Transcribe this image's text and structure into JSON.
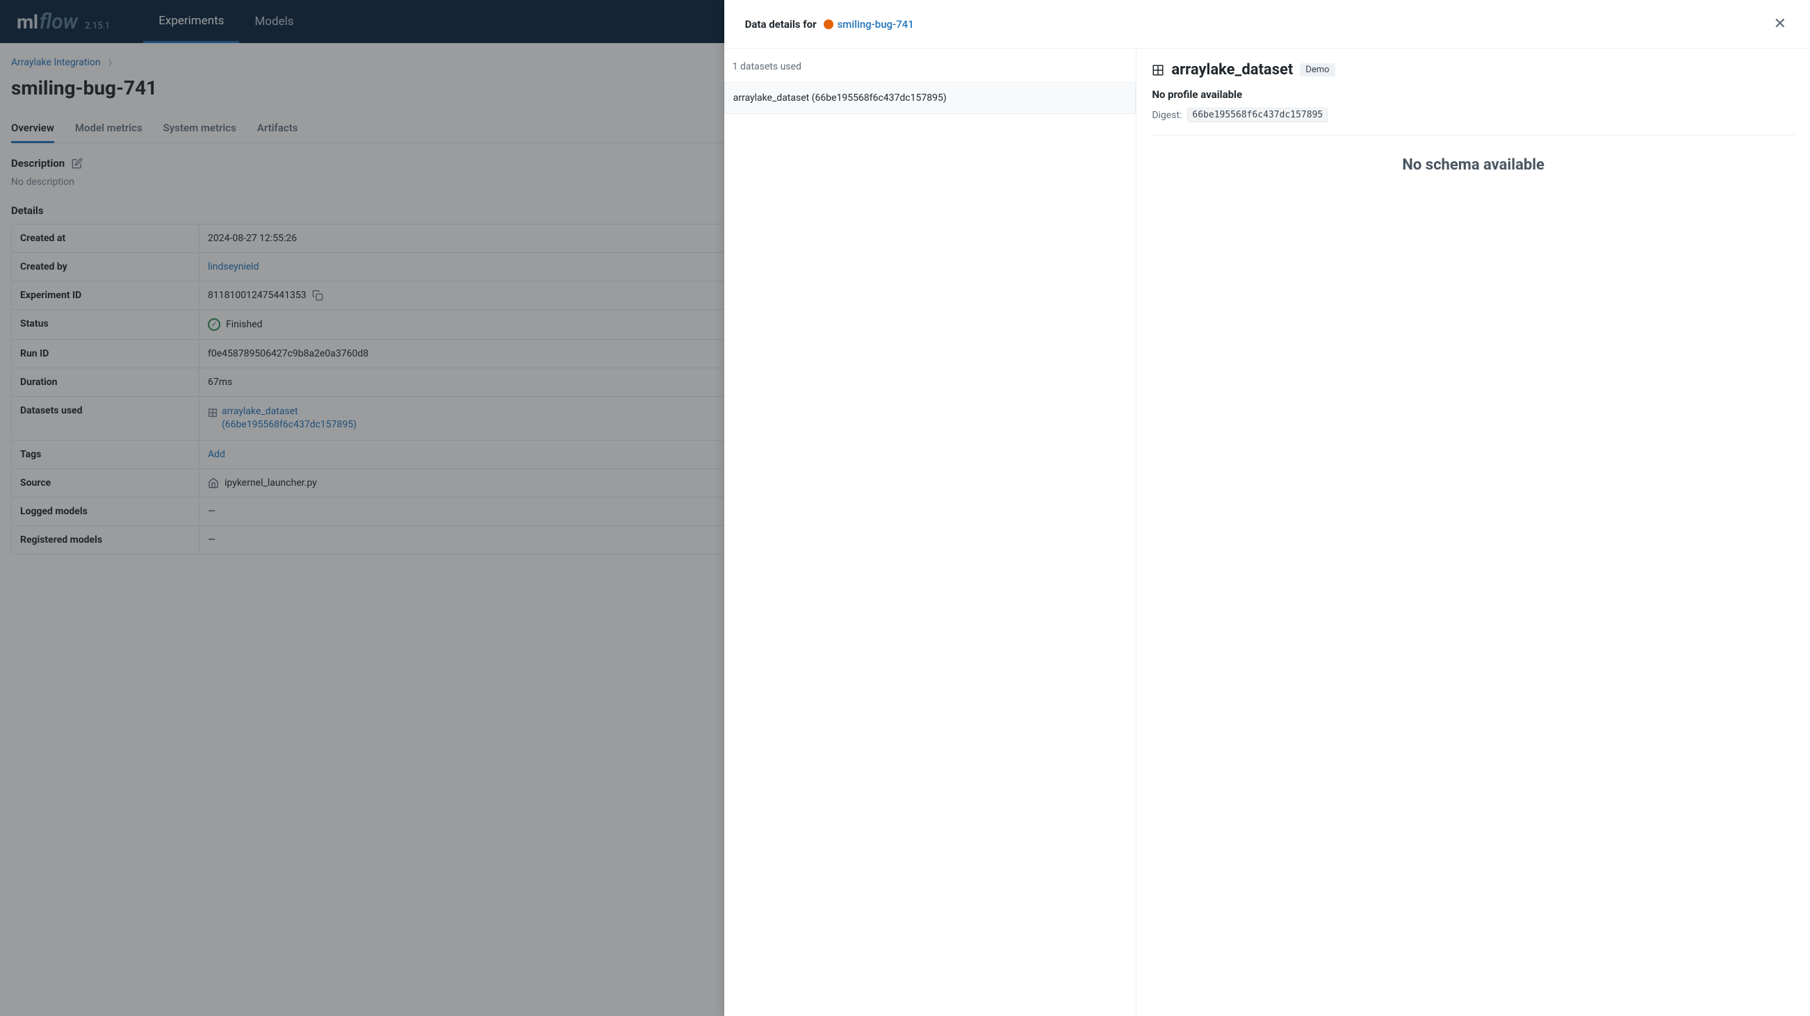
{
  "brand": {
    "ml": "ml",
    "flow": "flow",
    "version": "2.15.1"
  },
  "nav": {
    "experiments": "Experiments",
    "models": "Models"
  },
  "breadcrumb": {
    "parent": "Arraylake Integration"
  },
  "page_title": "smiling-bug-741",
  "tabs": {
    "overview": "Overview",
    "model_metrics": "Model metrics",
    "system_metrics": "System metrics",
    "artifacts": "Artifacts"
  },
  "description": {
    "label": "Description",
    "empty": "No description"
  },
  "details": {
    "header": "Details",
    "rows": {
      "created_at": {
        "key": "Created at",
        "val": "2024-08-27 12:55:26"
      },
      "created_by": {
        "key": "Created by",
        "val": "lindseynield"
      },
      "experiment_id": {
        "key": "Experiment ID",
        "val": "811810012475441353"
      },
      "status": {
        "key": "Status",
        "val": "Finished"
      },
      "run_id": {
        "key": "Run ID",
        "val": "f0e458789506427c9b8a2e0a3760d8"
      },
      "duration": {
        "key": "Duration",
        "val": "67ms"
      },
      "datasets_used": {
        "key": "Datasets used",
        "name": "arraylake_dataset",
        "digest": "(66be195568f6c437dc157895)"
      },
      "tags": {
        "key": "Tags",
        "val": "Add"
      },
      "source": {
        "key": "Source",
        "val": "ipykernel_launcher.py"
      },
      "logged_models": {
        "key": "Logged models",
        "val": "—"
      },
      "registered_models": {
        "key": "Registered models",
        "val": "—"
      }
    }
  },
  "panel": {
    "header_prefix": "Data details for",
    "run_name": "smiling-bug-741",
    "left": {
      "count_label": "1 datasets used",
      "item_text": "arraylake_dataset (66be195568f6c437dc157895)"
    },
    "right": {
      "dataset_name": "arraylake_dataset",
      "badge": "Demo",
      "profile_none": "No profile available",
      "digest_label": "Digest:",
      "digest_value": "66be195568f6c437dc157895",
      "no_schema": "No schema available"
    }
  }
}
